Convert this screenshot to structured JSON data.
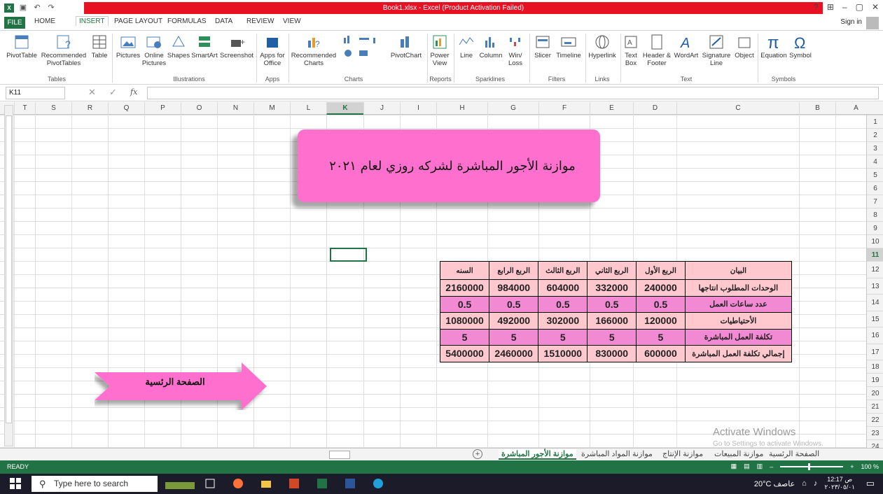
{
  "window": {
    "title": "Book1.xlsx -  Excel (Product Activation Failed)",
    "help": "?",
    "restore": "⊞",
    "minimize": "–",
    "maximize": "▢",
    "close": "✕"
  },
  "tabs": [
    "FILE",
    "HOME",
    "INSERT",
    "PAGE LAYOUT",
    "FORMULAS",
    "DATA",
    "REVIEW",
    "VIEW"
  ],
  "signin": "Sign in",
  "ribbon": {
    "buttons": [
      "PivotTable",
      "Recommended PivotTables",
      "Table",
      "Pictures",
      "Online Pictures",
      "Shapes",
      "SmartArt",
      "Screenshot",
      "Apps for Office",
      "Recommended Charts",
      "PivotChart",
      "Power View",
      "Line",
      "Column",
      "Win/ Loss",
      "Slicer",
      "Timeline",
      "Hyperlink",
      "Text Box",
      "Header & Footer",
      "WordArt",
      "Signature Line",
      "Object",
      "Equation",
      "Symbol"
    ],
    "groups": [
      "Tables",
      "Illustrations",
      "Apps",
      "Charts",
      "Reports",
      "Sparklines",
      "Filters",
      "Links",
      "Text",
      "Symbols"
    ]
  },
  "formula": {
    "namebox": "K11",
    "fx": "fx",
    "value": ""
  },
  "columns": [
    "T",
    "S",
    "R",
    "Q",
    "P",
    "O",
    "N",
    "M",
    "L",
    "K",
    "J",
    "I",
    "H",
    "G",
    "F",
    "E",
    "D",
    "C",
    "B",
    "A"
  ],
  "selected_column": "K",
  "rows": [
    "1",
    "2",
    "3",
    "4",
    "5",
    "6",
    "7",
    "8",
    "9",
    "10",
    "11",
    "12",
    "13",
    "14",
    "15",
    "16",
    "17",
    "18",
    "19",
    "20",
    "21",
    "22",
    "23",
    "24"
  ],
  "selected_row": "11",
  "banner_text": "موازنة الأجور المباشرة لشركه روزي لعام ٢٠٢١",
  "arrow_text": "الصفحة الرئسية",
  "table": {
    "header": [
      "البيان",
      "الربع الأول",
      "الربع الثاني",
      "الربع الثالث",
      "الربع الرابع",
      "السنه"
    ],
    "rows": [
      [
        "الوحدات المطلوب انتاجها",
        "240000",
        "332000",
        "604000",
        "984000",
        "2160000"
      ],
      [
        "عدد ساعات العمل",
        "0.5",
        "0.5",
        "0.5",
        "0.5",
        "0.5"
      ],
      [
        "الأحتياطيات",
        "120000",
        "166000",
        "302000",
        "492000",
        "1080000"
      ],
      [
        "تكلفة العمل المباشرة",
        "5",
        "5",
        "5",
        "5",
        "5"
      ],
      [
        "إجمالي تكلفة العمل المباشرة",
        "600000",
        "830000",
        "1510000",
        "2460000",
        "5400000"
      ]
    ]
  },
  "sheets": [
    "الصفحة الرئسية",
    "موازنة المبيعات",
    "موازنة الإنتاج",
    "موازنة المواد المباشرة",
    "موازنة الأجور المباشرة"
  ],
  "active_sheet": "موازنة الأجور المباشرة",
  "status": {
    "ready": "READY",
    "zoom": "100 %",
    "zoom_minus": "–",
    "zoom_plus": "+"
  },
  "watermark": {
    "line1": "Activate Windows",
    "line2": "Go to Settings to activate Windows."
  },
  "taskbar": {
    "search_placeholder": "Type here to search",
    "weather": "20°C  عاصف",
    "time": "12:17 ص",
    "date": "٢٠٢٣/٠٥/٠١"
  },
  "colors": {
    "excel_green": "#217346",
    "title_red": "#e81123",
    "banner_pink": "#ff6fce",
    "row_pink": "#f28ad3",
    "row_light": "#ffc7ce"
  }
}
